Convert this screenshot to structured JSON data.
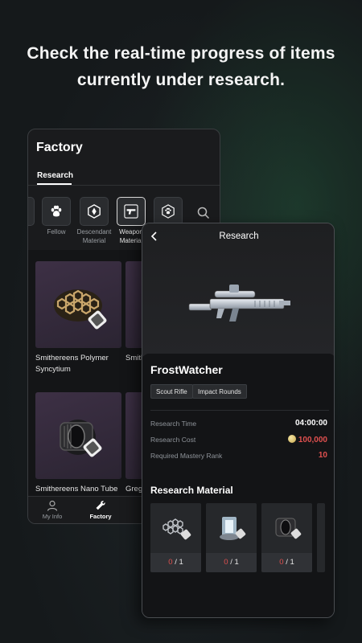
{
  "headline": {
    "line1": "Check the real-time progress of items",
    "line2": "currently under research."
  },
  "factory": {
    "title": "Factory",
    "tab": "Research",
    "categories": [
      {
        "label": "Fellow",
        "icon": "paw-icon"
      },
      {
        "label": "Descendant Material",
        "icon": "descendant-icon"
      },
      {
        "label": "Weapon Material",
        "icon": "pistol-icon",
        "active": true
      },
      {
        "label": "",
        "icon": "paw-badge-icon"
      }
    ],
    "items": [
      {
        "name": "Smithereens Polymer Syncytium"
      },
      {
        "name": "Smithereens Fiber"
      },
      {
        "name": "Smithereens Nano Tube"
      },
      {
        "name": "Gregg"
      }
    ],
    "nav": [
      {
        "label": "My Info",
        "icon": "person-icon"
      },
      {
        "label": "Factory",
        "icon": "wrench-icon",
        "active": true
      }
    ]
  },
  "research": {
    "title": "Research",
    "weapon_name": "FrostWatcher",
    "tags": [
      "Scout Rifle",
      "Impact Rounds"
    ],
    "stats": [
      {
        "label": "Research Time",
        "value": "04:00:00"
      },
      {
        "label": "Research Cost",
        "value": "100,000"
      },
      {
        "label": "Required Mastery Rank",
        "value": "10"
      }
    ],
    "materials_title": "Research Material",
    "materials": [
      {
        "have": "0",
        "need": "/ 1"
      },
      {
        "have": "0",
        "need": "/ 1"
      },
      {
        "have": "0",
        "need": "/ 1"
      }
    ]
  },
  "colors": {
    "accent_red": "#e0504f",
    "item_card": "#3d3045",
    "background": "#15191b"
  }
}
